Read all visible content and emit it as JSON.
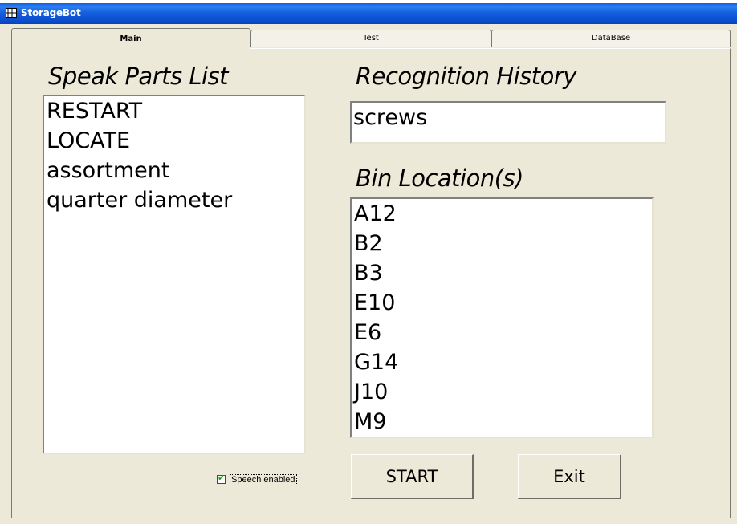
{
  "window": {
    "title": "StorageBot"
  },
  "tabs": [
    {
      "label": "Main",
      "active": true
    },
    {
      "label": "Test",
      "active": false
    },
    {
      "label": "DataBase",
      "active": false
    }
  ],
  "main": {
    "speak_parts": {
      "heading": "Speak Parts List",
      "items": [
        "RESTART",
        "LOCATE",
        "assortment",
        "quarter diameter"
      ]
    },
    "recognition": {
      "heading": "Recognition History",
      "value": "screws"
    },
    "bins": {
      "heading": "Bin Location(s)",
      "items": [
        "A12",
        "B2",
        "B3",
        "E10",
        "E6",
        "G14",
        "J10",
        "M9"
      ]
    },
    "speech_checkbox": {
      "label": "Speech enabled",
      "checked": true
    },
    "start_label": "START",
    "exit_label": "Exit"
  },
  "colors": {
    "titlebar": "#0a4fd0",
    "face": "#ece9d8",
    "check": "#21a121"
  },
  "icons": {
    "app": "storagebot-app-icon"
  }
}
